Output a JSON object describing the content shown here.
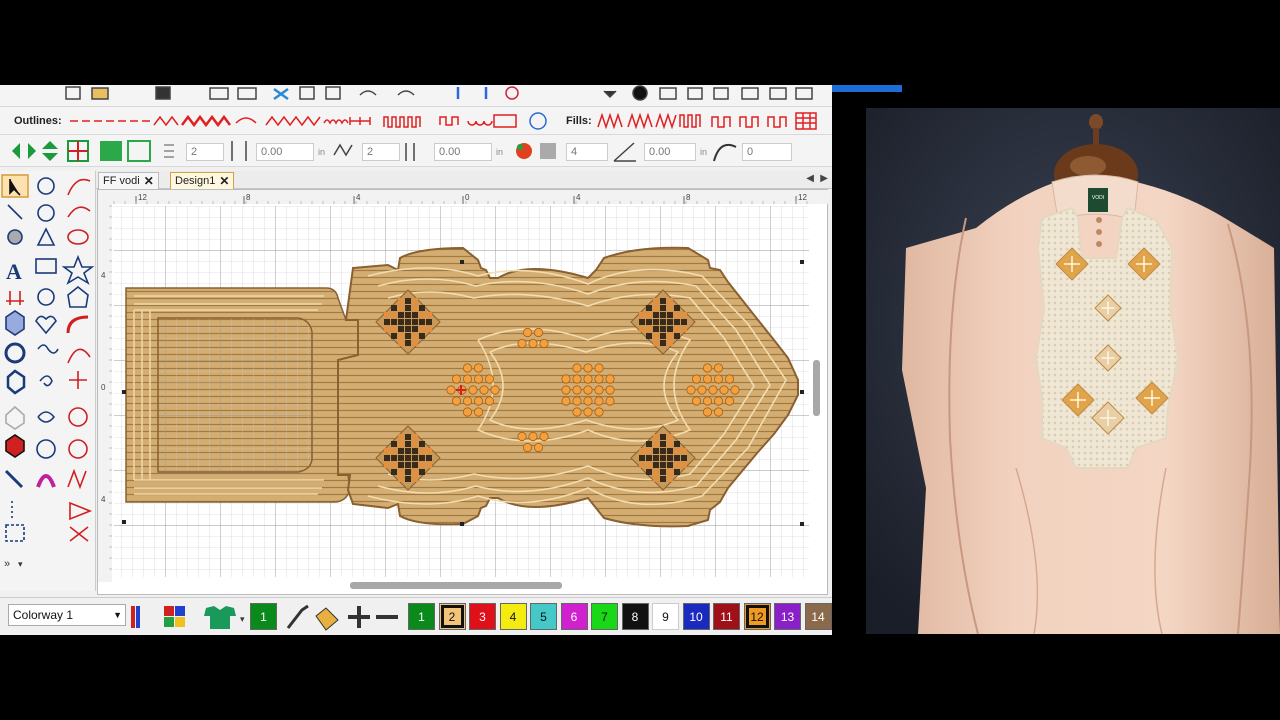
{
  "toolbar2": {
    "outlines_label": "Outlines:",
    "fills_label": "Fills:"
  },
  "toolbar3": {
    "field1": "2",
    "field2": "0.00",
    "unit1": "in",
    "field3": "2",
    "field4": "0.00",
    "unit2": "in",
    "field5": "4",
    "field6": "0.00",
    "unit3": "in",
    "field7": "0"
  },
  "tabs": [
    {
      "label": "FF vodi",
      "active": false
    },
    {
      "label": "Design1",
      "active": true
    }
  ],
  "ruler": {
    "top_ticks": [
      "12",
      "8",
      "4",
      "0",
      "4",
      "8",
      "12"
    ],
    "left_ticks": [
      "4",
      "0",
      "4"
    ]
  },
  "bottom": {
    "colorway": "Colorway 1",
    "current_color_number": "1",
    "swatches": [
      {
        "n": "1",
        "color": "#0a8a1a",
        "selected": false
      },
      {
        "n": "2",
        "color": "#f1c47a",
        "selected": true
      },
      {
        "n": "3",
        "color": "#e0101a",
        "selected": false
      },
      {
        "n": "4",
        "color": "#f4ec10",
        "selected": false
      },
      {
        "n": "5",
        "color": "#44c8c8",
        "selected": false
      },
      {
        "n": "6",
        "color": "#d020d0",
        "selected": false
      },
      {
        "n": "7",
        "color": "#18d818",
        "selected": false
      },
      {
        "n": "8",
        "color": "#111111",
        "selected": true
      },
      {
        "n": "9",
        "color": "#ffffff",
        "selected": false
      },
      {
        "n": "10",
        "color": "#1a2ac0",
        "selected": false
      },
      {
        "n": "11",
        "color": "#a01018",
        "selected": false
      },
      {
        "n": "12",
        "color": "#f09a20",
        "selected": true
      },
      {
        "n": "13",
        "color": "#8a20c8",
        "selected": false
      },
      {
        "n": "14",
        "color": "#8a6a4a",
        "selected": false
      }
    ]
  },
  "photo": {
    "tag_text": "VODI"
  },
  "colors": {
    "accent": "#d6a040",
    "toolbar_red": "#e02020",
    "design_tan": "#c8a068",
    "design_dark": "#a47a40",
    "garment": "#f0cdb8",
    "bg_photo": "#252a38"
  }
}
